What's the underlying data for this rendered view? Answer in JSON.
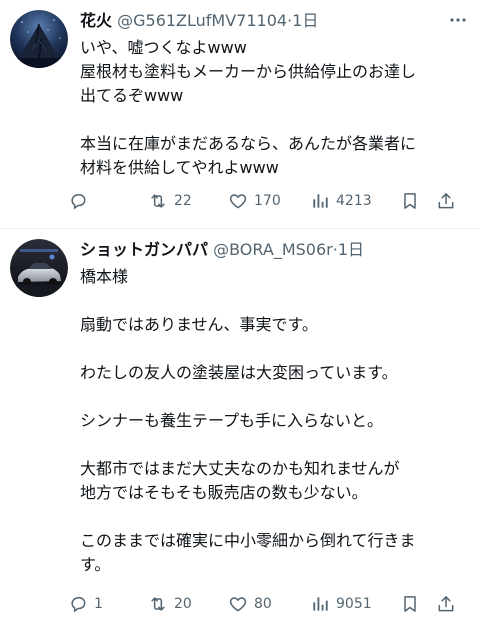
{
  "posts": [
    {
      "name": "花火",
      "handle": "@G561ZLufMV71104",
      "separator": "·",
      "time": "1日",
      "lines": [
        "いや、嘘つくなよwww",
        "屋根材も塗料もメーカーから供給停止のお達し",
        "出てるぞwww",
        "",
        "本当に在庫がまだあるなら、あんたが各業者に",
        "材料を供給してやれよwww"
      ],
      "reply_count": "",
      "retweet_count": "22",
      "like_count": "170",
      "view_count": "4213"
    },
    {
      "name": "ショットガンパパ",
      "handle": "@BORA_MS06r",
      "separator": "·",
      "time": "1日",
      "lines": [
        "橋本様",
        "",
        "扇動ではありません、事実です。",
        "",
        "わたしの友人の塗装屋は大変困っています。",
        "",
        "シンナーも養生テープも手に入らないと。",
        "",
        "大都市ではまだ大丈夫なのかも知れませんが",
        "地方ではそもそも販売店の数も少ない。",
        "",
        "このままでは確実に中小零細から倒れて行きま",
        "す。"
      ],
      "reply_count": "1",
      "retweet_count": "20",
      "like_count": "80",
      "view_count": "9051"
    }
  ],
  "icons": {
    "more": "more-horizontal-icon",
    "reply": "reply-icon",
    "retweet": "retweet-icon",
    "like": "like-icon",
    "views": "views-icon",
    "bookmark": "bookmark-icon",
    "share": "share-icon"
  },
  "colors": {
    "text": "#0f1419",
    "secondary": "#536471",
    "divider": "#eff3f4"
  }
}
